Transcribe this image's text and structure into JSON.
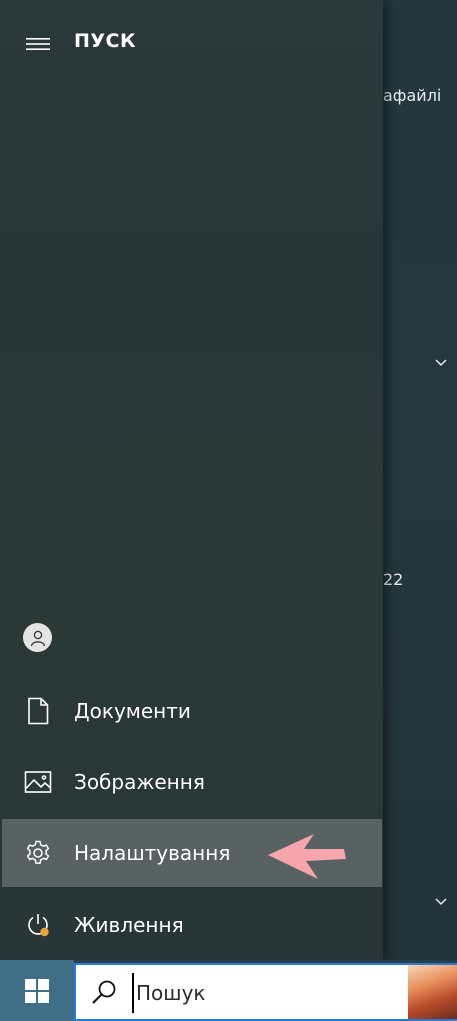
{
  "start": {
    "title": "ПУСК"
  },
  "rail": {
    "items": [
      {
        "label": "Документи",
        "icon": "document-icon"
      },
      {
        "label": "Зображення",
        "icon": "picture-icon"
      },
      {
        "label": "Налаштування",
        "icon": "gear-icon",
        "highlighted": true
      },
      {
        "label": "Живлення",
        "icon": "power-icon"
      }
    ]
  },
  "tiles_peek": {
    "text_top": "афайлі",
    "text_mid": "22"
  },
  "taskbar": {
    "search_placeholder": "Пошук"
  },
  "colors": {
    "rail_bg": "#28363a",
    "highlight": "#5a6466",
    "start_button": "#3f6f86",
    "search_border": "#2a7bd6",
    "arrow": "#f4a6ac",
    "power_badge": "#f0a030"
  }
}
